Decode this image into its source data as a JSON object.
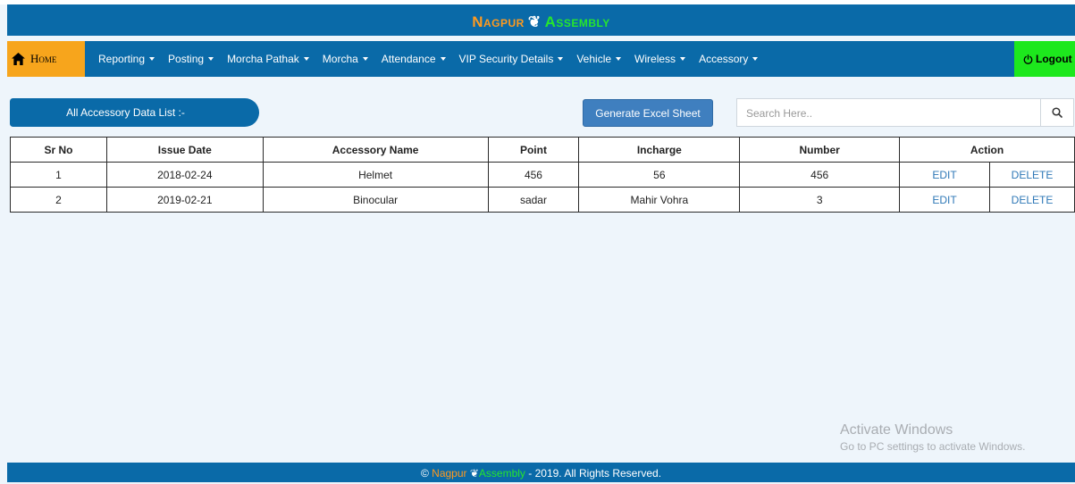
{
  "brand": {
    "part1": "Nagpur",
    "sep": "❦",
    "part2": "Assembly"
  },
  "nav": {
    "home": "Home",
    "items": [
      "Reporting",
      "Posting",
      "Morcha Pathak",
      "Morcha",
      "Attendance",
      "VIP Security Details",
      "Vehicle",
      "Wireless",
      "Accessory"
    ],
    "logout": "Logout"
  },
  "list_title": "All Accessory Data List :-",
  "excel_button": "Generate Excel Sheet",
  "search": {
    "placeholder": "Search Here.."
  },
  "table": {
    "headers": [
      "Sr No",
      "Issue Date",
      "Accessory Name",
      "Point",
      "Incharge",
      "Number",
      "Action"
    ],
    "rows": [
      {
        "sr": "1",
        "date": "2018-02-24",
        "name": "Helmet",
        "point": "456",
        "incharge": "56",
        "number": "456",
        "edit": "EDIT",
        "delete": "DELETE"
      },
      {
        "sr": "2",
        "date": "2019-02-21",
        "name": "Binocular",
        "point": "sadar",
        "incharge": "Mahir Vohra",
        "number": "3",
        "edit": "EDIT",
        "delete": "DELETE"
      }
    ]
  },
  "watermark": {
    "title": "Activate Windows",
    "subtitle": "Go to PC settings to activate Windows."
  },
  "footer": {
    "copy": "©",
    "part1": "Nagpur",
    "sep": "❦",
    "part2": "Assembly",
    "rest": "- 2019. All Rights Reserved."
  },
  "colors": {
    "primary": "#0a6aa8",
    "home_bg": "#f7a51c",
    "logout_bg": "#1de81d",
    "link": "#2f78b7"
  }
}
